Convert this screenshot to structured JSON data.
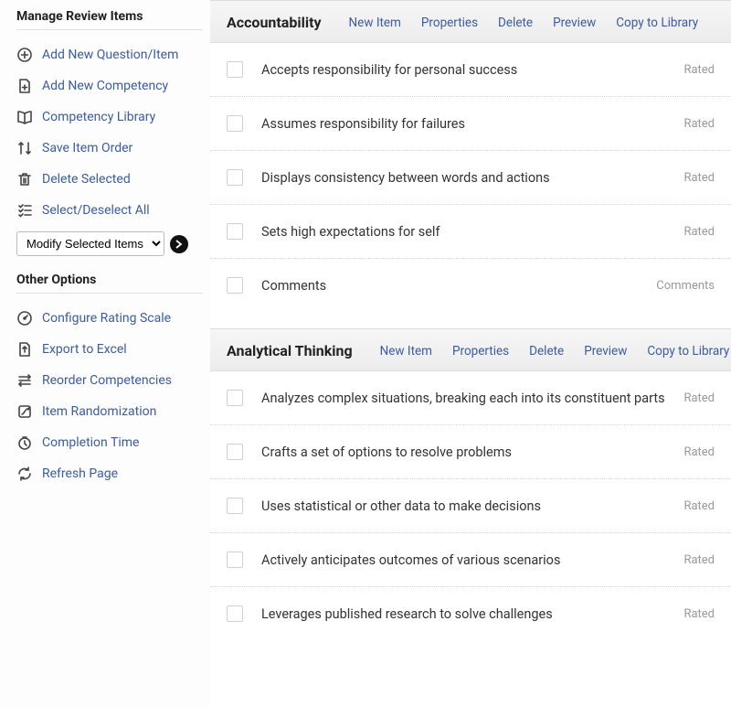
{
  "sidebar": {
    "manage_heading": "Manage Review Items",
    "items": [
      {
        "label": "Add New Question/Item",
        "icon": "plus-circle"
      },
      {
        "label": "Add New Competency",
        "icon": "file-plus"
      },
      {
        "label": "Competency Library",
        "icon": "book"
      },
      {
        "label": "Save Item Order",
        "icon": "sort"
      },
      {
        "label": "Delete Selected",
        "icon": "trash"
      },
      {
        "label": "Select/Deselect All",
        "icon": "checklist"
      }
    ],
    "dropdown_label": "Modify Selected Items",
    "other_heading": "Other Options",
    "other_items": [
      {
        "label": "Configure Rating Scale",
        "icon": "gauge"
      },
      {
        "label": "Export to Excel",
        "icon": "export"
      },
      {
        "label": "Reorder Competencies",
        "icon": "reorder"
      },
      {
        "label": "Item Randomization",
        "icon": "shuffle"
      },
      {
        "label": "Completion Time",
        "icon": "clock"
      },
      {
        "label": "Refresh Page",
        "icon": "refresh"
      }
    ]
  },
  "competencies": [
    {
      "title": "Accountability",
      "actions": [
        "New Item",
        "Properties",
        "Delete",
        "Preview",
        "Copy to Library"
      ],
      "items": [
        {
          "text": "Accepts responsibility for personal success",
          "type": "Rated"
        },
        {
          "text": "Assumes responsibility for failures",
          "type": "Rated"
        },
        {
          "text": "Displays consistency between words and actions",
          "type": "Rated"
        },
        {
          "text": "Sets high expectations for self",
          "type": "Rated"
        },
        {
          "text": "Comments",
          "type": "Comments"
        }
      ]
    },
    {
      "title": "Analytical Thinking",
      "actions": [
        "New Item",
        "Properties",
        "Delete",
        "Preview",
        "Copy to Library"
      ],
      "items": [
        {
          "text": "Analyzes complex situations, breaking each into its constituent parts",
          "type": "Rated"
        },
        {
          "text": "Crafts a set of options to resolve problems",
          "type": "Rated"
        },
        {
          "text": "Uses statistical or other data to make decisions",
          "type": "Rated"
        },
        {
          "text": "Actively anticipates outcomes of various scenarios",
          "type": "Rated"
        },
        {
          "text": "Leverages published research to solve challenges",
          "type": "Rated"
        }
      ]
    }
  ]
}
